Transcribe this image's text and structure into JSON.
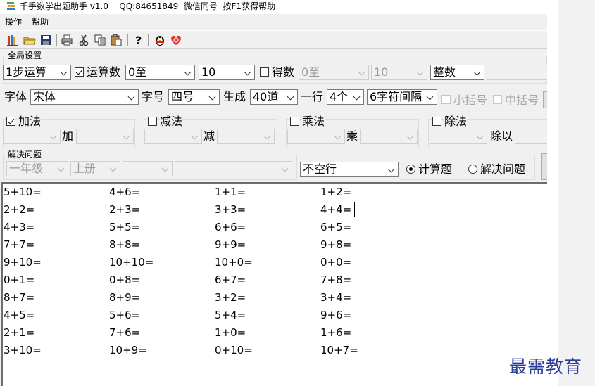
{
  "window": {
    "title": "千手数学出题助手 v1.0    QQ:84651849  微信同号  按F1获得帮助"
  },
  "menu": [
    {
      "label": "操作"
    },
    {
      "label": "帮助"
    }
  ],
  "toolbar": [
    {
      "icon": "books-icon"
    },
    {
      "icon": "open-folder-icon"
    },
    {
      "icon": "save-icon"
    },
    {
      "icon": "print-icon"
    },
    {
      "icon": "cut-icon"
    },
    {
      "icon": "copy-icon"
    },
    {
      "icon": "paste-icon"
    },
    {
      "icon": "help-icon"
    },
    {
      "icon": "qq-penguin-icon"
    },
    {
      "icon": "heart-icon"
    }
  ],
  "global_settings": {
    "title": "全局设置",
    "steps": "1步运算",
    "operands": {
      "label": "运算数",
      "checked": true,
      "from": "0至",
      "to": "10"
    },
    "result": {
      "label": "得数",
      "checked": false,
      "from": "0至",
      "to": "10"
    },
    "number_type": "整数"
  },
  "font_row": {
    "font_label": "字体",
    "font": "宋体",
    "size_label": "字号",
    "size": "四号",
    "generate_label": "生成",
    "count": "40道",
    "per_row_label": "一行",
    "per_row": "4个",
    "spacing": "6字符间隔",
    "small_bracket": "小括号",
    "mid_bracket": "中括号"
  },
  "operations": {
    "add": {
      "label": "加法",
      "checked": true,
      "op": "加"
    },
    "sub": {
      "label": "减法",
      "checked": false,
      "op": "减"
    },
    "mul": {
      "label": "乘法",
      "checked": false,
      "op": "乘"
    },
    "div": {
      "label": "除法",
      "checked": false,
      "op": "除以"
    }
  },
  "word_problems": {
    "title": "解决问题",
    "grade": "一年级",
    "term": "上册",
    "line_mode": "不空行",
    "mode_calc": "计算题",
    "mode_word": "解决问题",
    "selected_mode": "计算题"
  },
  "equations": [
    [
      "5+10=",
      "4+6=",
      "1+1=",
      "1+2="
    ],
    [
      "2+2=",
      "2+3=",
      "3+3=",
      "4+4="
    ],
    [
      "4+3=",
      "5+5=",
      "6+6=",
      "6+5="
    ],
    [
      "7+7=",
      "8+8=",
      "9+9=",
      "9+8="
    ],
    [
      "9+10=",
      "10+10=",
      "10+0=",
      "0+0="
    ],
    [
      "0+1=",
      "0+8=",
      "6+7=",
      "7+8="
    ],
    [
      "8+7=",
      "8+9=",
      "3+2=",
      "3+4="
    ],
    [
      "4+5=",
      "5+6=",
      "5+4=",
      "9+6="
    ],
    [
      "2+1=",
      "7+6=",
      "1+0=",
      "1+6="
    ],
    [
      "3+10=",
      "10+9=",
      "0+10=",
      "10+7="
    ]
  ],
  "watermark": "最需教育"
}
